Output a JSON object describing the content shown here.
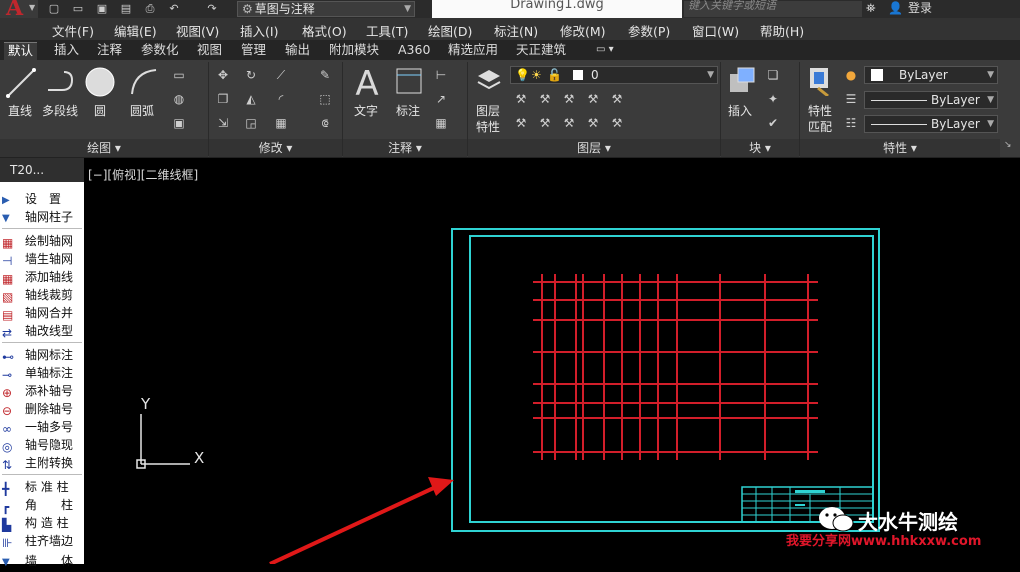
{
  "titlebar": {
    "app_logo": "A",
    "workspace": "草图与注释",
    "document": "Drawing1.dwg",
    "search_placeholder": "键入关键字或短语",
    "login": "登录"
  },
  "menu": [
    "文件(F)",
    "编辑(E)",
    "视图(V)",
    "插入(I)",
    "格式(O)",
    "工具(T)",
    "绘图(D)",
    "标注(N)",
    "修改(M)",
    "参数(P)",
    "窗口(W)",
    "帮助(H)"
  ],
  "tabs": [
    "默认",
    "插入",
    "注释",
    "参数化",
    "视图",
    "管理",
    "输出",
    "附加模块",
    "A360",
    "精选应用",
    "天正建筑"
  ],
  "ribbon": {
    "draw": {
      "line": "直线",
      "polyline": "多段线",
      "circle": "圆",
      "arc": "圆弧",
      "title": "绘图"
    },
    "modify": {
      "title": "修改"
    },
    "annotation": {
      "text": "文字",
      "dimension": "标注",
      "title": "注释"
    },
    "layers": {
      "properties_line1": "图层",
      "properties_line2": "特性",
      "current_layer": "0",
      "title": "图层"
    },
    "block": {
      "insert": "插入",
      "title": "块"
    },
    "properties": {
      "match_line1": "特性",
      "match_line2": "匹配",
      "color": "ByLayer",
      "linetype": "ByLayer",
      "lineweight": "ByLayer",
      "title": "特性"
    }
  },
  "palette": {
    "title": "T20...",
    "items": [
      "设　置",
      "轴网柱子",
      "绘制轴网",
      "墙生轴网",
      "添加轴线",
      "轴线裁剪",
      "轴网合并",
      "轴改线型",
      "轴网标注",
      "单轴标注",
      "添补轴号",
      "删除轴号",
      "一轴多号",
      "轴号隐现",
      "主附转换",
      "标 准 柱",
      "角　　柱",
      "构 造 柱",
      "柱齐墙边",
      "墙　　体"
    ]
  },
  "canvas": {
    "view_label": "[−][俯视][二维线框]",
    "ucs_y": "Y",
    "ucs_x": "X"
  },
  "watermark": {
    "brand": "大水牛测绘",
    "url": "我要分享网www.hhkxxw.com"
  },
  "colors": {
    "frame": "#2fd3d3",
    "grid": "#d21e2a",
    "arrow": "#e01818",
    "canvas_bg": "#000000"
  }
}
